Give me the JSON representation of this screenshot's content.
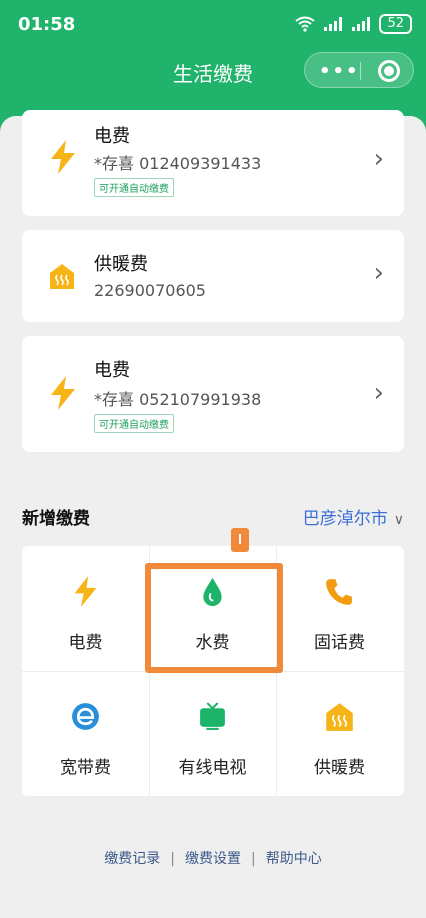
{
  "status_bar": {
    "time": "01:58",
    "battery": "52"
  },
  "nav": {
    "title": "生活缴费"
  },
  "accounts": [
    {
      "name": "电费",
      "account": "*存喜  012409391433",
      "tag": "可开通自动缴费",
      "icon": "lightning-icon"
    },
    {
      "name": "供暖费",
      "account": "22690070605",
      "icon": "heating-icon"
    },
    {
      "name": "电费",
      "account": "*存喜  052107991938",
      "tag": "可开通自动缴费",
      "icon": "lightning-icon"
    }
  ],
  "new_payment": {
    "title": "新增缴费",
    "city": "巴彦淖尔市",
    "items": [
      {
        "label": "电费",
        "icon": "lightning-icon",
        "color": "#f6b417"
      },
      {
        "label": "水费",
        "icon": "water-drop-icon",
        "color": "#1db46a"
      },
      {
        "label": "固话费",
        "icon": "phone-icon",
        "color": "#f39c12"
      },
      {
        "label": "宽带费",
        "icon": "broadband-icon",
        "color": "#2a8fd9"
      },
      {
        "label": "有线电视",
        "icon": "tv-icon",
        "color": "#1db46a"
      },
      {
        "label": "供暖费",
        "icon": "heating-icon",
        "color": "#f6b417"
      }
    ]
  },
  "footer": {
    "records": "缴费记录",
    "settings": "缴费设置",
    "help": "帮助中心"
  },
  "colors": {
    "brand": "#20b36b",
    "highlight": "#f08a3a",
    "link": "#3a6fd8"
  }
}
